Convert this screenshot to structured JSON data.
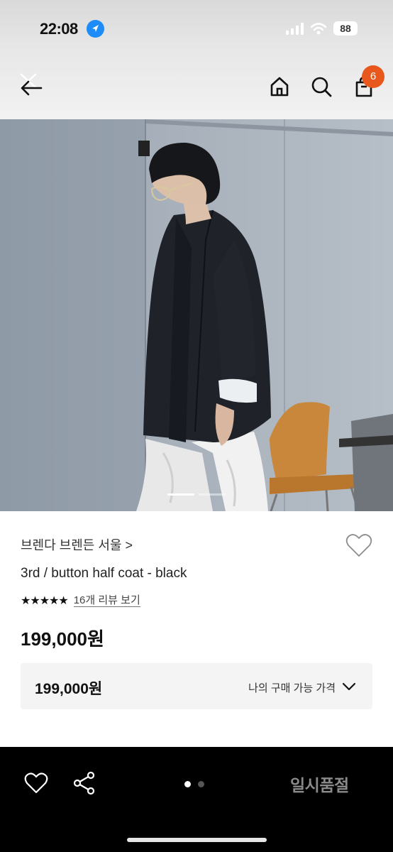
{
  "status_bar": {
    "time": "22:08",
    "battery": "88"
  },
  "header": {
    "cart_count": "6"
  },
  "product": {
    "brand": "브렌다 브렌든 서울 >",
    "name": "3rd / button half coat - black",
    "rating_stars": "★★★★★",
    "rating_value": 5,
    "review_link": "16개 리뷰 보기",
    "price": "199,000원"
  },
  "price_box": {
    "price": "199,000원",
    "label": "나의 구매 가능 가격"
  },
  "bottom_bar": {
    "status_button": "일시품절"
  },
  "colors": {
    "accent": "#e8581c",
    "location_badge": "#1d8cf8"
  },
  "icons": [
    "close-icon",
    "back-arrow-icon",
    "home-icon",
    "search-icon",
    "shopping-bag-icon",
    "heart-icon",
    "chevron-down-icon",
    "share-icon"
  ]
}
